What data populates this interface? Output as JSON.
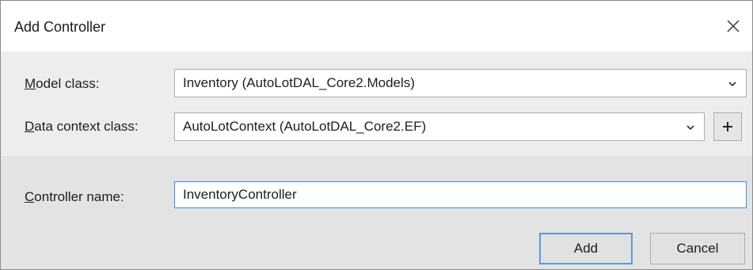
{
  "dialog": {
    "title": "Add Controller",
    "close_icon": "close-icon"
  },
  "model_class": {
    "label_accel": "M",
    "label_rest": "odel class:",
    "value": "Inventory (AutoLotDAL_Core2.Models)"
  },
  "data_context": {
    "label_accel": "D",
    "label_rest": "ata context class:",
    "value": "AutoLotContext (AutoLotDAL_Core2.EF)",
    "add_icon": "plus-icon"
  },
  "controller_name": {
    "label_accel": "C",
    "label_rest": "ontroller name:",
    "value": "InventoryController"
  },
  "buttons": {
    "add": "Add",
    "cancel": "Cancel"
  },
  "colors": {
    "focus_border": "#3b8de0",
    "default_button_border": "#5b9bd5",
    "top_panel_bg": "#ededed",
    "bottom_panel_bg": "#e3e3e3"
  }
}
